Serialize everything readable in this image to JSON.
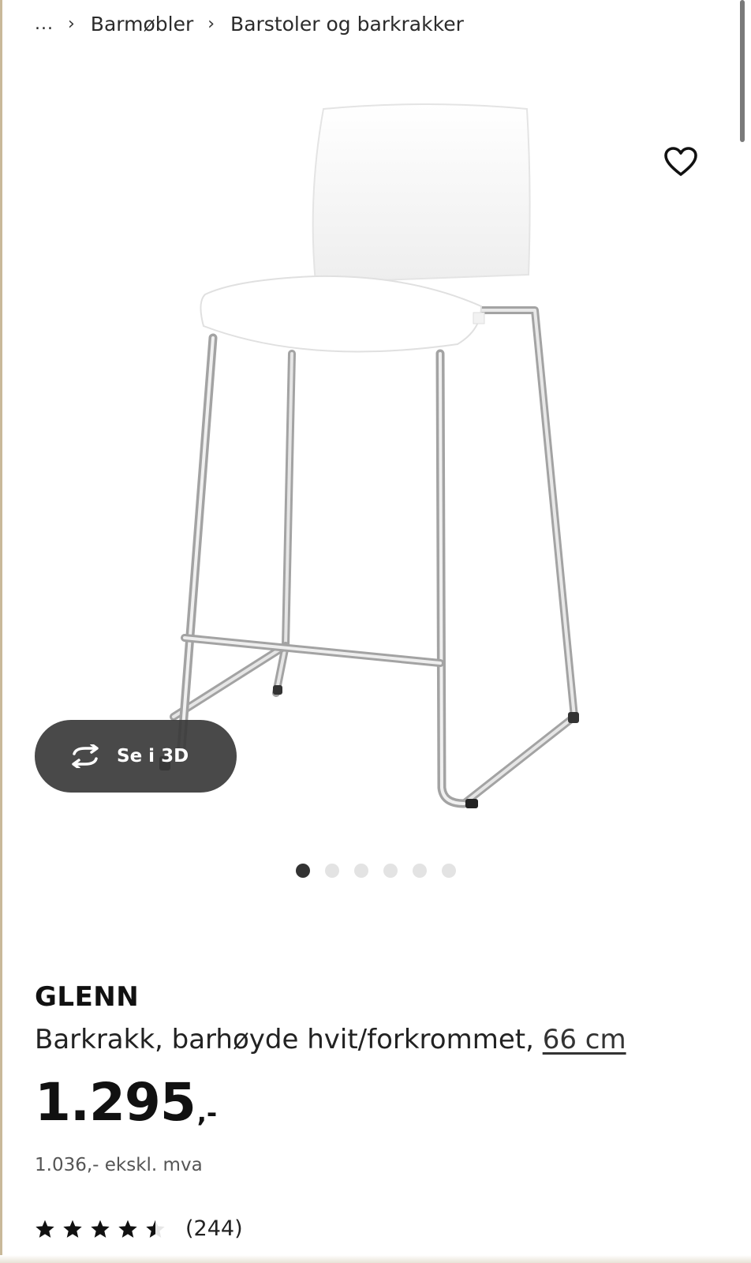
{
  "breadcrumb": {
    "ellipsis": "...",
    "items": [
      "Barmøbler",
      "Barstoler og barkrakker"
    ]
  },
  "icons": {
    "favorite": "heart-outline-icon",
    "rotate_3d": "rotate-arrows-icon",
    "breadcrumb_separator": "chevron-right-icon",
    "rating_star": "star-icon"
  },
  "gallery": {
    "see_3d_label": "Se i 3D",
    "image_count": 6,
    "active_index": 0
  },
  "product": {
    "name": "GLENN",
    "description": "Barkrakk, barhøyde hvit/forkrommet,",
    "size_link": "66 cm",
    "price": "1.295",
    "price_suffix": ",-",
    "price_excl_vat": "1.036,- ekskl. mva",
    "rating": 4.5,
    "rating_max": 5,
    "review_count": "(244)"
  },
  "colors": {
    "text": "#111111",
    "pill_bg": "#3a3a3a",
    "dot_active": "#333333",
    "dot_inactive": "#e3e3e3"
  }
}
